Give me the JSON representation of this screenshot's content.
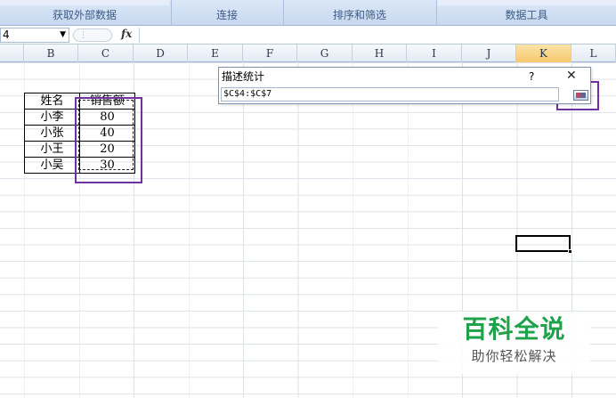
{
  "ribbon": {
    "groups": [
      "获取外部数据",
      "连接",
      "排序和筛选",
      "数据工具"
    ]
  },
  "formula_bar": {
    "name_box": "4",
    "name_box_dropdown": "▼",
    "fx": "fx",
    "value": ""
  },
  "columns": [
    "B",
    "C",
    "D",
    "E",
    "F",
    "G",
    "H",
    "I",
    "J",
    "K",
    "L"
  ],
  "selected_column": "K",
  "table": {
    "headers": [
      "姓名",
      "销售额"
    ],
    "rows": [
      {
        "name": "小李",
        "sales": "80"
      },
      {
        "name": "小张",
        "sales": "40"
      },
      {
        "name": "小王",
        "sales": "20"
      },
      {
        "name": "小吴",
        "sales": "30"
      }
    ]
  },
  "dialog": {
    "title": "描述统计",
    "help": "?",
    "close": "✕",
    "reference": "$C$4:$C$7"
  },
  "watermark": {
    "title": "百科全说",
    "subtitle": "助你轻松解决"
  },
  "colors": {
    "annotation": "#7030a0",
    "watermark": "#1fa24a",
    "selected_header": "#f6c96c"
  }
}
